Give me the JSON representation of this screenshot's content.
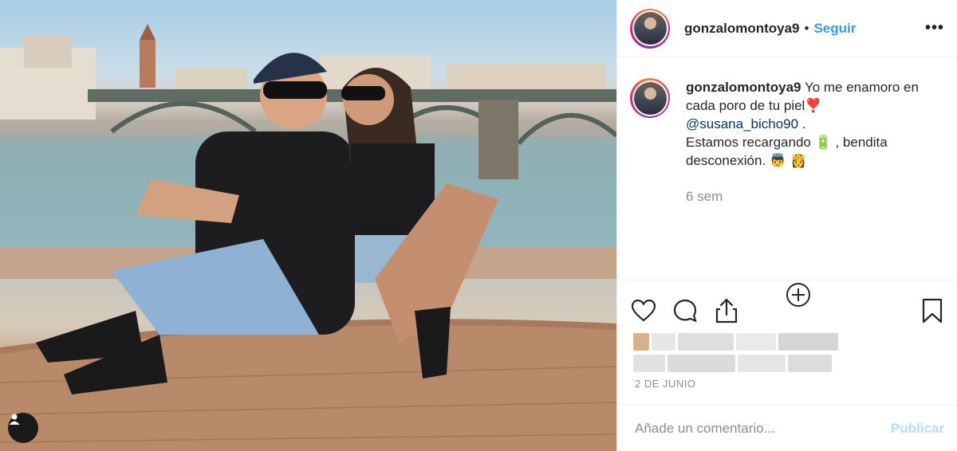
{
  "header": {
    "username": "gonzalomontoya9",
    "separator": "•",
    "follow_label": "Seguir",
    "more_label": "•••"
  },
  "caption": {
    "username": "gonzalomontoya9",
    "line1": "Yo me enamoro en cada poro de tu piel❣️",
    "mention": "@susana_bicho90",
    "line2_after_mention": " .",
    "line3": "Estamos recargando 🔋 , bendita desconexión. 👼 👸",
    "time": "6 sem"
  },
  "post": {
    "date": "2 DE JUNIO"
  },
  "comment": {
    "placeholder": "Añade un comentario...",
    "publish_label": "Publicar"
  },
  "icons": {
    "like": "heart-icon",
    "comment": "comment-icon",
    "share": "share-icon",
    "save": "bookmark-icon",
    "add": "plus-circle-icon",
    "user_tag": "user-icon"
  },
  "colors": {
    "accent": "#3897f0",
    "publish_disabled": "#b2dffc",
    "secondary_text": "#8e8e8e"
  }
}
